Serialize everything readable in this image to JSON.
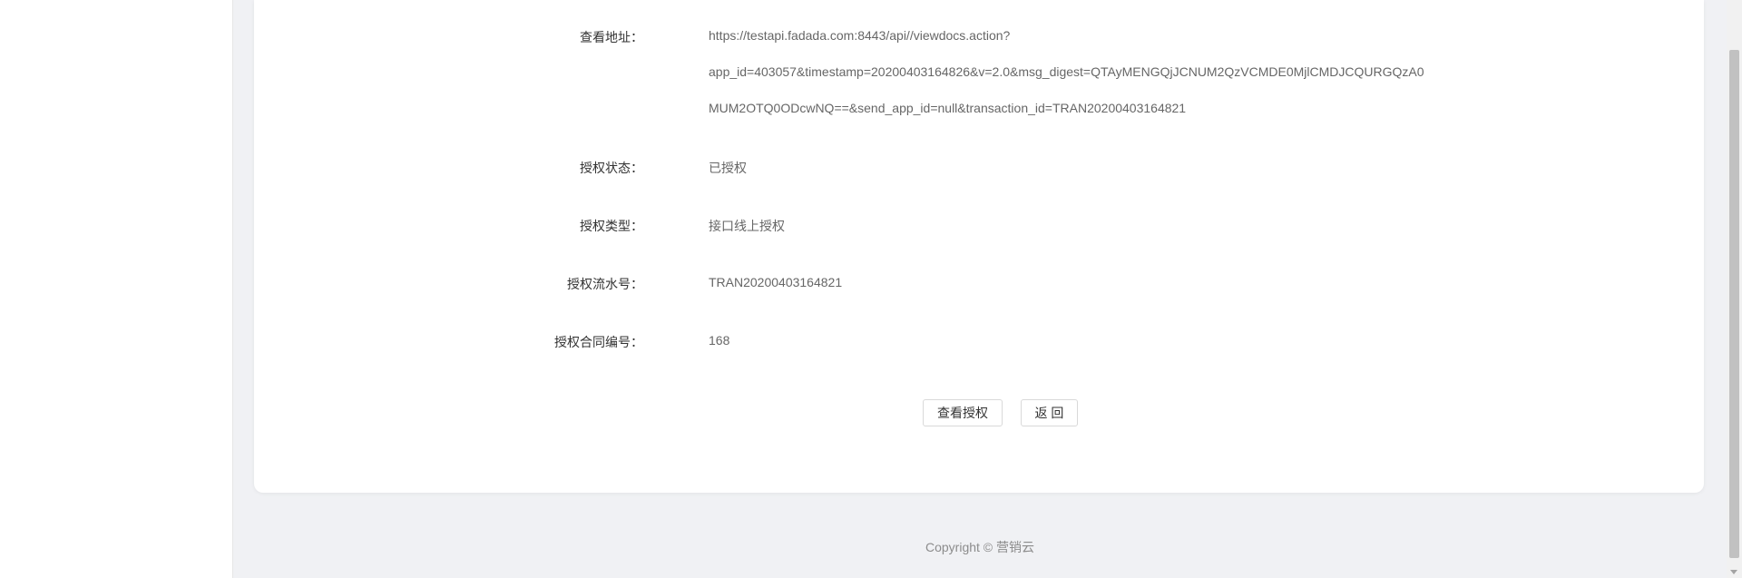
{
  "detail": {
    "view_address": {
      "label": "查看地址：",
      "lines": [
        "https://testapi.fadada.com:8443/api//viewdocs.action?",
        "app_id=403057&timestamp=20200403164826&v=2.0&msg_digest=QTAyMENGQjJCNUM2QzVCMDE0MjlCMDJCQURGQzA0",
        "MUM2OTQ0ODcwNQ==&send_app_id=null&transaction_id=TRAN20200403164821"
      ]
    },
    "auth_status": {
      "label": "授权状态：",
      "value": "已授权"
    },
    "auth_type": {
      "label": "授权类型：",
      "value": "接口线上授权"
    },
    "auth_serial": {
      "label": "授权流水号：",
      "value": "TRAN20200403164821"
    },
    "auth_contract_no": {
      "label": "授权合同编号：",
      "value": "168"
    }
  },
  "actions": {
    "view_auth_label": "查看授权",
    "back_label": "返 回"
  },
  "footer": {
    "copyright": "Copyright © 营销云"
  }
}
